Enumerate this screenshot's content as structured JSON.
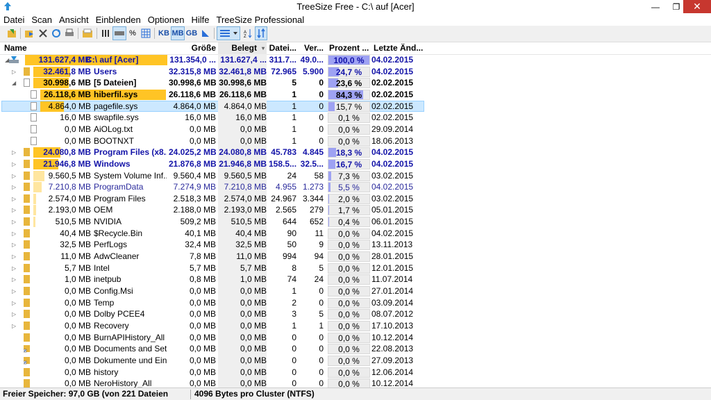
{
  "window": {
    "title": "TreeSize Free - C:\\  auf  [Acer]",
    "min": "—",
    "max": "❐",
    "close": "✕"
  },
  "menu": [
    "Datei",
    "Scan",
    "Ansicht",
    "Einblenden",
    "Optionen",
    "Hilfe",
    "TreeSize Professional"
  ],
  "toolbar": {
    "pct": "%",
    "kb": "KB",
    "mb": "MB",
    "gb": "GB"
  },
  "columns": {
    "name": "Name",
    "groesse": "Größe",
    "belegt": "Belegt",
    "dateien": "Datei...",
    "ver": "Ver...",
    "prozent": "Prozent ...",
    "datum": "Letzte Änd..."
  },
  "rows": [
    {
      "size": "131.627,4 MB",
      "name": "C:\\  auf  [Acer]",
      "groesse": "131.354,0 ...",
      "belegt": "131.627,4 ...",
      "dateien": "311.7...",
      "ver": "49.0...",
      "pct": "100,0 %",
      "pct_value": 100.0,
      "datum": "04.02.2015",
      "style": "blue bold",
      "kind": "drive",
      "level": 0,
      "bar": 1.0,
      "expander": "◢"
    },
    {
      "size": "32.461,8 MB",
      "name": "Users",
      "groesse": "32.315,8 MB",
      "belegt": "32.461,8 MB",
      "dateien": "72.965",
      "ver": "5.900",
      "pct": "24,7 %",
      "pct_value": 24.7,
      "datum": "04.02.2015",
      "style": "blue bold",
      "kind": "folder",
      "level": 1,
      "bar": 0.247,
      "expander": "▷"
    },
    {
      "size": "30.998,6 MB",
      "name": "[5 Dateien]",
      "groesse": "30.998,6 MB",
      "belegt": "30.998,6 MB",
      "dateien": "5",
      "ver": "0",
      "pct": "23,6 %",
      "pct_value": 23.6,
      "datum": "02.02.2015",
      "style": "dark bold",
      "kind": "file",
      "level": 1,
      "bar": 0.236,
      "expander": "◢"
    },
    {
      "size": "26.118,6 MB",
      "name": "hiberfil.sys",
      "groesse": "26.118,6 MB",
      "belegt": "26.118,6 MB",
      "dateien": "1",
      "ver": "0",
      "pct": "84,3 %",
      "pct_value": 84.3,
      "datum": "02.02.2015",
      "style": "dark bold",
      "kind": "file",
      "level": 2,
      "bar": 0.843,
      "expander": ""
    },
    {
      "size": "4.864,0 MB",
      "name": "pagefile.sys",
      "groesse": "4.864,0 MB",
      "belegt": "4.864,0 MB",
      "dateien": "1",
      "ver": "0",
      "pct": "15,7 %",
      "pct_value": 15.7,
      "datum": "02.02.2015",
      "style": "dark",
      "kind": "file",
      "level": 2,
      "bar": 0.157,
      "expander": "",
      "selected": true
    },
    {
      "size": "16,0 MB",
      "name": "swapfile.sys",
      "groesse": "16,0 MB",
      "belegt": "16,0 MB",
      "dateien": "1",
      "ver": "0",
      "pct": "0,1 %",
      "pct_value": 0.1,
      "datum": "02.02.2015",
      "style": "dark",
      "kind": "file",
      "level": 2,
      "bar": 0.0,
      "expander": ""
    },
    {
      "size": "0,0 MB",
      "name": "AiOLog.txt",
      "groesse": "0,0 MB",
      "belegt": "0,0 MB",
      "dateien": "1",
      "ver": "0",
      "pct": "0,0 %",
      "pct_value": 0.0,
      "datum": "29.09.2014",
      "style": "dark",
      "kind": "file",
      "level": 2,
      "bar": 0.0,
      "expander": ""
    },
    {
      "size": "0,0 MB",
      "name": "BOOTNXT",
      "groesse": "0,0 MB",
      "belegt": "0,0 MB",
      "dateien": "1",
      "ver": "0",
      "pct": "0,0 %",
      "pct_value": 0.0,
      "datum": "18.06.2013",
      "style": "dark",
      "kind": "file",
      "level": 2,
      "bar": 0.0,
      "expander": ""
    },
    {
      "size": "24.080,8 MB",
      "name": "Program Files (x8...",
      "groesse": "24.025,2 MB",
      "belegt": "24.080,8 MB",
      "dateien": "45.783",
      "ver": "4.845",
      "pct": "18,3 %",
      "pct_value": 18.3,
      "datum": "04.02.2015",
      "style": "blue bold",
      "kind": "folder",
      "level": 1,
      "bar": 0.183,
      "expander": "▷"
    },
    {
      "size": "21.946,8 MB",
      "name": "Windows",
      "groesse": "21.876,8 MB",
      "belegt": "21.946,8 MB",
      "dateien": "158.5...",
      "ver": "32.5...",
      "pct": "16,7 %",
      "pct_value": 16.7,
      "datum": "04.02.2015",
      "style": "blue bold",
      "kind": "folder",
      "level": 1,
      "bar": 0.167,
      "expander": "▷"
    },
    {
      "size": "9.560,5 MB",
      "name": "System Volume Inf...",
      "groesse": "9.560,4 MB",
      "belegt": "9.560,5 MB",
      "dateien": "24",
      "ver": "58",
      "pct": "7,3 %",
      "pct_value": 7.3,
      "datum": "03.02.2015",
      "style": "dark",
      "kind": "folder",
      "level": 1,
      "bar": 0.073,
      "expander": "▷"
    },
    {
      "size": "7.210,8 MB",
      "name": "ProgramData",
      "groesse": "7.274,9 MB",
      "belegt": "7.210,8 MB",
      "dateien": "4.955",
      "ver": "1.273",
      "pct": "5,5 %",
      "pct_value": 5.5,
      "datum": "04.02.2015",
      "style": "navy",
      "kind": "folder",
      "level": 1,
      "bar": 0.055,
      "expander": "▷"
    },
    {
      "size": "2.574,0 MB",
      "name": "Program Files",
      "groesse": "2.518,3 MB",
      "belegt": "2.574,0 MB",
      "dateien": "24.967",
      "ver": "3.344",
      "pct": "2,0 %",
      "pct_value": 2.0,
      "datum": "03.02.2015",
      "style": "dark",
      "kind": "folder",
      "level": 1,
      "bar": 0.02,
      "expander": "▷"
    },
    {
      "size": "2.193,0 MB",
      "name": "OEM",
      "groesse": "2.188,0 MB",
      "belegt": "2.193,0 MB",
      "dateien": "2.565",
      "ver": "279",
      "pct": "1,7 %",
      "pct_value": 1.7,
      "datum": "05.01.2015",
      "style": "dark",
      "kind": "folder",
      "level": 1,
      "bar": 0.017,
      "expander": "▷"
    },
    {
      "size": "510,5 MB",
      "name": "NVIDIA",
      "groesse": "509,2 MB",
      "belegt": "510,5 MB",
      "dateien": "644",
      "ver": "652",
      "pct": "0,4 %",
      "pct_value": 0.4,
      "datum": "06.01.2015",
      "style": "dark",
      "kind": "folder",
      "level": 1,
      "bar": 0.004,
      "expander": "▷"
    },
    {
      "size": "40,4 MB",
      "name": "$Recycle.Bin",
      "groesse": "40,1 MB",
      "belegt": "40,4 MB",
      "dateien": "90",
      "ver": "11",
      "pct": "0,0 %",
      "pct_value": 0.0,
      "datum": "04.02.2015",
      "style": "dark",
      "kind": "folder",
      "level": 1,
      "bar": 0.0,
      "expander": "▷"
    },
    {
      "size": "32,5 MB",
      "name": "PerfLogs",
      "groesse": "32,4 MB",
      "belegt": "32,5 MB",
      "dateien": "50",
      "ver": "9",
      "pct": "0,0 %",
      "pct_value": 0.0,
      "datum": "13.11.2013",
      "style": "dark",
      "kind": "folder",
      "level": 1,
      "bar": 0.0,
      "expander": "▷"
    },
    {
      "size": "11,0 MB",
      "name": "AdwCleaner",
      "groesse": "7,8 MB",
      "belegt": "11,0 MB",
      "dateien": "994",
      "ver": "94",
      "pct": "0,0 %",
      "pct_value": 0.0,
      "datum": "28.01.2015",
      "style": "dark",
      "kind": "folder",
      "level": 1,
      "bar": 0.0,
      "expander": "▷"
    },
    {
      "size": "5,7 MB",
      "name": "Intel",
      "groesse": "5,7 MB",
      "belegt": "5,7 MB",
      "dateien": "8",
      "ver": "5",
      "pct": "0,0 %",
      "pct_value": 0.0,
      "datum": "12.01.2015",
      "style": "dark",
      "kind": "folder",
      "level": 1,
      "bar": 0.0,
      "expander": "▷"
    },
    {
      "size": "1,0 MB",
      "name": "inetpub",
      "groesse": "0,8 MB",
      "belegt": "1,0 MB",
      "dateien": "74",
      "ver": "24",
      "pct": "0,0 %",
      "pct_value": 0.0,
      "datum": "11.07.2014",
      "style": "dark",
      "kind": "folder",
      "level": 1,
      "bar": 0.0,
      "expander": "▷"
    },
    {
      "size": "0,0 MB",
      "name": "Config.Msi",
      "groesse": "0,0 MB",
      "belegt": "0,0 MB",
      "dateien": "1",
      "ver": "0",
      "pct": "0,0 %",
      "pct_value": 0.0,
      "datum": "27.01.2014",
      "style": "dark",
      "kind": "folder",
      "level": 1,
      "bar": 0.0,
      "expander": "▷"
    },
    {
      "size": "0,0 MB",
      "name": "Temp",
      "groesse": "0,0 MB",
      "belegt": "0,0 MB",
      "dateien": "2",
      "ver": "0",
      "pct": "0,0 %",
      "pct_value": 0.0,
      "datum": "03.09.2014",
      "style": "dark",
      "kind": "folder",
      "level": 1,
      "bar": 0.0,
      "expander": "▷"
    },
    {
      "size": "0,0 MB",
      "name": "Dolby PCEE4",
      "groesse": "0,0 MB",
      "belegt": "0,0 MB",
      "dateien": "3",
      "ver": "5",
      "pct": "0,0 %",
      "pct_value": 0.0,
      "datum": "08.07.2012",
      "style": "dark",
      "kind": "folder",
      "level": 1,
      "bar": 0.0,
      "expander": "▷"
    },
    {
      "size": "0,0 MB",
      "name": "Recovery",
      "groesse": "0,0 MB",
      "belegt": "0,0 MB",
      "dateien": "1",
      "ver": "1",
      "pct": "0,0 %",
      "pct_value": 0.0,
      "datum": "17.10.2013",
      "style": "dark",
      "kind": "folder",
      "level": 1,
      "bar": 0.0,
      "expander": "▷"
    },
    {
      "size": "0,0 MB",
      "name": "BurnAPIHistory_All",
      "groesse": "0,0 MB",
      "belegt": "0,0 MB",
      "dateien": "0",
      "ver": "0",
      "pct": "0,0 %",
      "pct_value": 0.0,
      "datum": "10.12.2014",
      "style": "dark",
      "kind": "folder",
      "level": 1,
      "bar": 0.0,
      "expander": ""
    },
    {
      "size": "0,0 MB",
      "name": "Documents and Set...",
      "groesse": "0,0 MB",
      "belegt": "0,0 MB",
      "dateien": "0",
      "ver": "0",
      "pct": "0,0 %",
      "pct_value": 0.0,
      "datum": "22.08.2013",
      "style": "dark",
      "kind": "link",
      "level": 1,
      "bar": 0.0,
      "expander": ""
    },
    {
      "size": "0,0 MB",
      "name": "Dokumente und Ein...",
      "groesse": "0,0 MB",
      "belegt": "0,0 MB",
      "dateien": "0",
      "ver": "0",
      "pct": "0,0 %",
      "pct_value": 0.0,
      "datum": "27.09.2013",
      "style": "dark",
      "kind": "link",
      "level": 1,
      "bar": 0.0,
      "expander": ""
    },
    {
      "size": "0,0 MB",
      "name": "history",
      "groesse": "0,0 MB",
      "belegt": "0,0 MB",
      "dateien": "0",
      "ver": "0",
      "pct": "0,0 %",
      "pct_value": 0.0,
      "datum": "12.06.2014",
      "style": "dark",
      "kind": "folder",
      "level": 1,
      "bar": 0.0,
      "expander": ""
    },
    {
      "size": "0,0 MB",
      "name": "NeroHistory_All",
      "groesse": "0,0 MB",
      "belegt": "0,0 MB",
      "dateien": "0",
      "ver": "0",
      "pct": "0,0 %",
      "pct_value": 0.0,
      "datum": "10.12.2014",
      "style": "dark",
      "kind": "folder",
      "level": 1,
      "bar": 0.0,
      "expander": ""
    }
  ],
  "status": {
    "left": "Freier Speicher: 97,0 GB  (von 221  Dateien",
    "right": "4096 Bytes pro Cluster (NTFS)"
  },
  "colors": {
    "bar_big": "#ffc425",
    "bar_small": "#ffe6a0",
    "pct_fill": "#9ea2f3",
    "blue_text": "#1414a8",
    "close": "#c7372f"
  }
}
